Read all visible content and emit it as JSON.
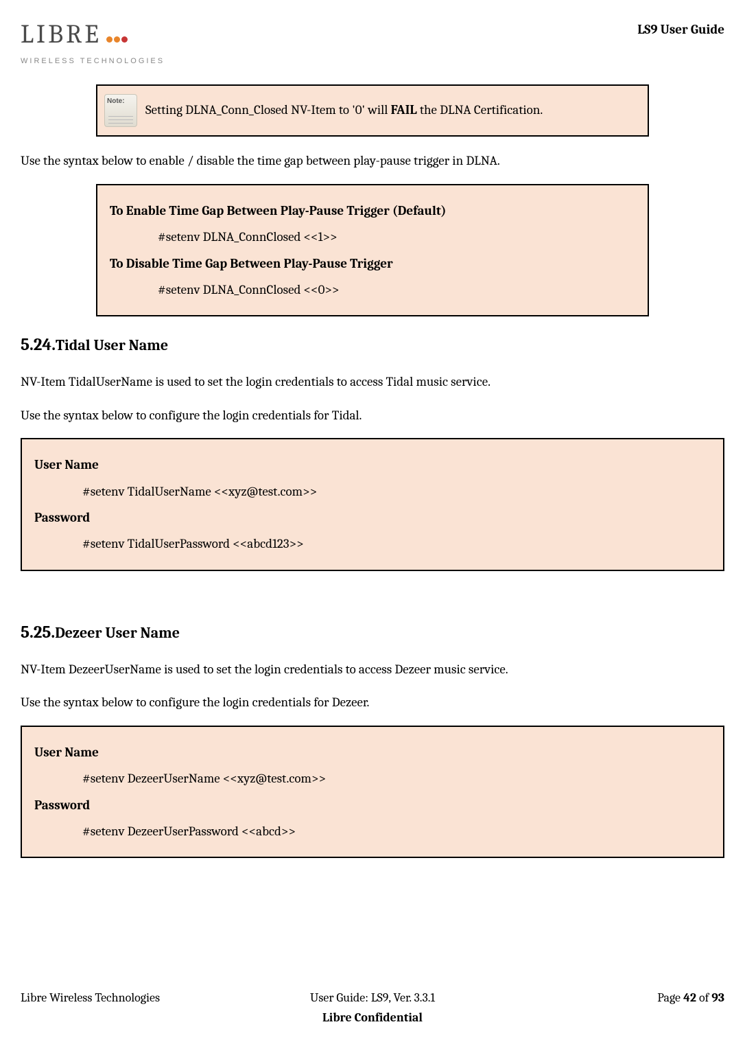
{
  "header": {
    "logo_text": "LIBRE",
    "logo_sub": "WIRELESS TECHNOLOGIES",
    "doc_title": "LS9 User Guide"
  },
  "note": {
    "icon_label": "Note:",
    "text_pre": "Setting DLNA_Conn_Closed NV-Item to '0' will ",
    "text_bold": "FAIL",
    "text_post": " the DLNA Certification."
  },
  "para1": "Use the syntax below to enable / disable the time gap between play-pause trigger in DLNA.",
  "box1": {
    "h1": "To Enable Time Gap Between Play-Pause Trigger (Default)",
    "c1": "#setenv DLNA_ConnClosed <<1>>",
    "h2": "To Disable Time Gap Between Play-Pause Trigger",
    "c2": "#setenv DLNA_ConnClosed <<0>>"
  },
  "section524": {
    "num": "5.24.",
    "title": "Tidal User Name",
    "p1": "NV-Item TidalUserName is used to set the login credentials to access Tidal music service.",
    "p2": "Use the syntax below to configure the login credentials for Tidal.",
    "box": {
      "h1": "User Name",
      "c1": "#setenv TidalUserName <<xyz@test.com>>",
      "h2": "Password",
      "c2": "#setenv TidalUserPassword  <<abcd123>>"
    }
  },
  "section525": {
    "num": "5.25.",
    "title": "Dezeer User Name",
    "p1": "NV-Item DezeerUserName is used to set the login credentials to access Dezeer music service.",
    "p2": "Use the syntax below to configure the login credentials for Dezeer.",
    "box": {
      "h1": "User Name",
      "c1": "#setenv DezeerUserName <<xyz@test.com>>",
      "h2": "Password",
      "c2": "#setenv DezeerUserPassword  <<abcd>>"
    }
  },
  "footer": {
    "left": "Libre Wireless Technologies",
    "center": "User Guide: LS9, Ver. 3.3.1",
    "right_pre": "Page ",
    "page": "42",
    "right_mid": " of ",
    "total": "93",
    "conf": "Libre Confidential"
  }
}
